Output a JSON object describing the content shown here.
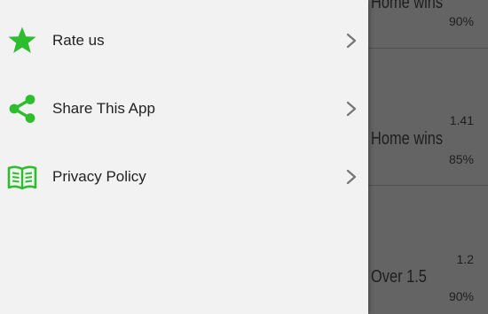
{
  "colors": {
    "accent_green": "#2ebd2e",
    "drawer_bg": "#f2f2f2",
    "scrim_bg": "#646464"
  },
  "drawer": {
    "items": [
      {
        "label": "Rate us",
        "icon": "star-icon"
      },
      {
        "label": "Share This App",
        "icon": "share-icon"
      },
      {
        "label": "Privacy Policy",
        "icon": "book-icon"
      }
    ]
  },
  "background": {
    "cards": [
      {
        "title": "Home wins",
        "odds": "",
        "percent": "90%"
      },
      {
        "title": "Home wins",
        "odds": "1.41",
        "percent": "85%"
      },
      {
        "title": "Over 1.5",
        "odds": "1.2",
        "percent": "90%"
      }
    ]
  }
}
